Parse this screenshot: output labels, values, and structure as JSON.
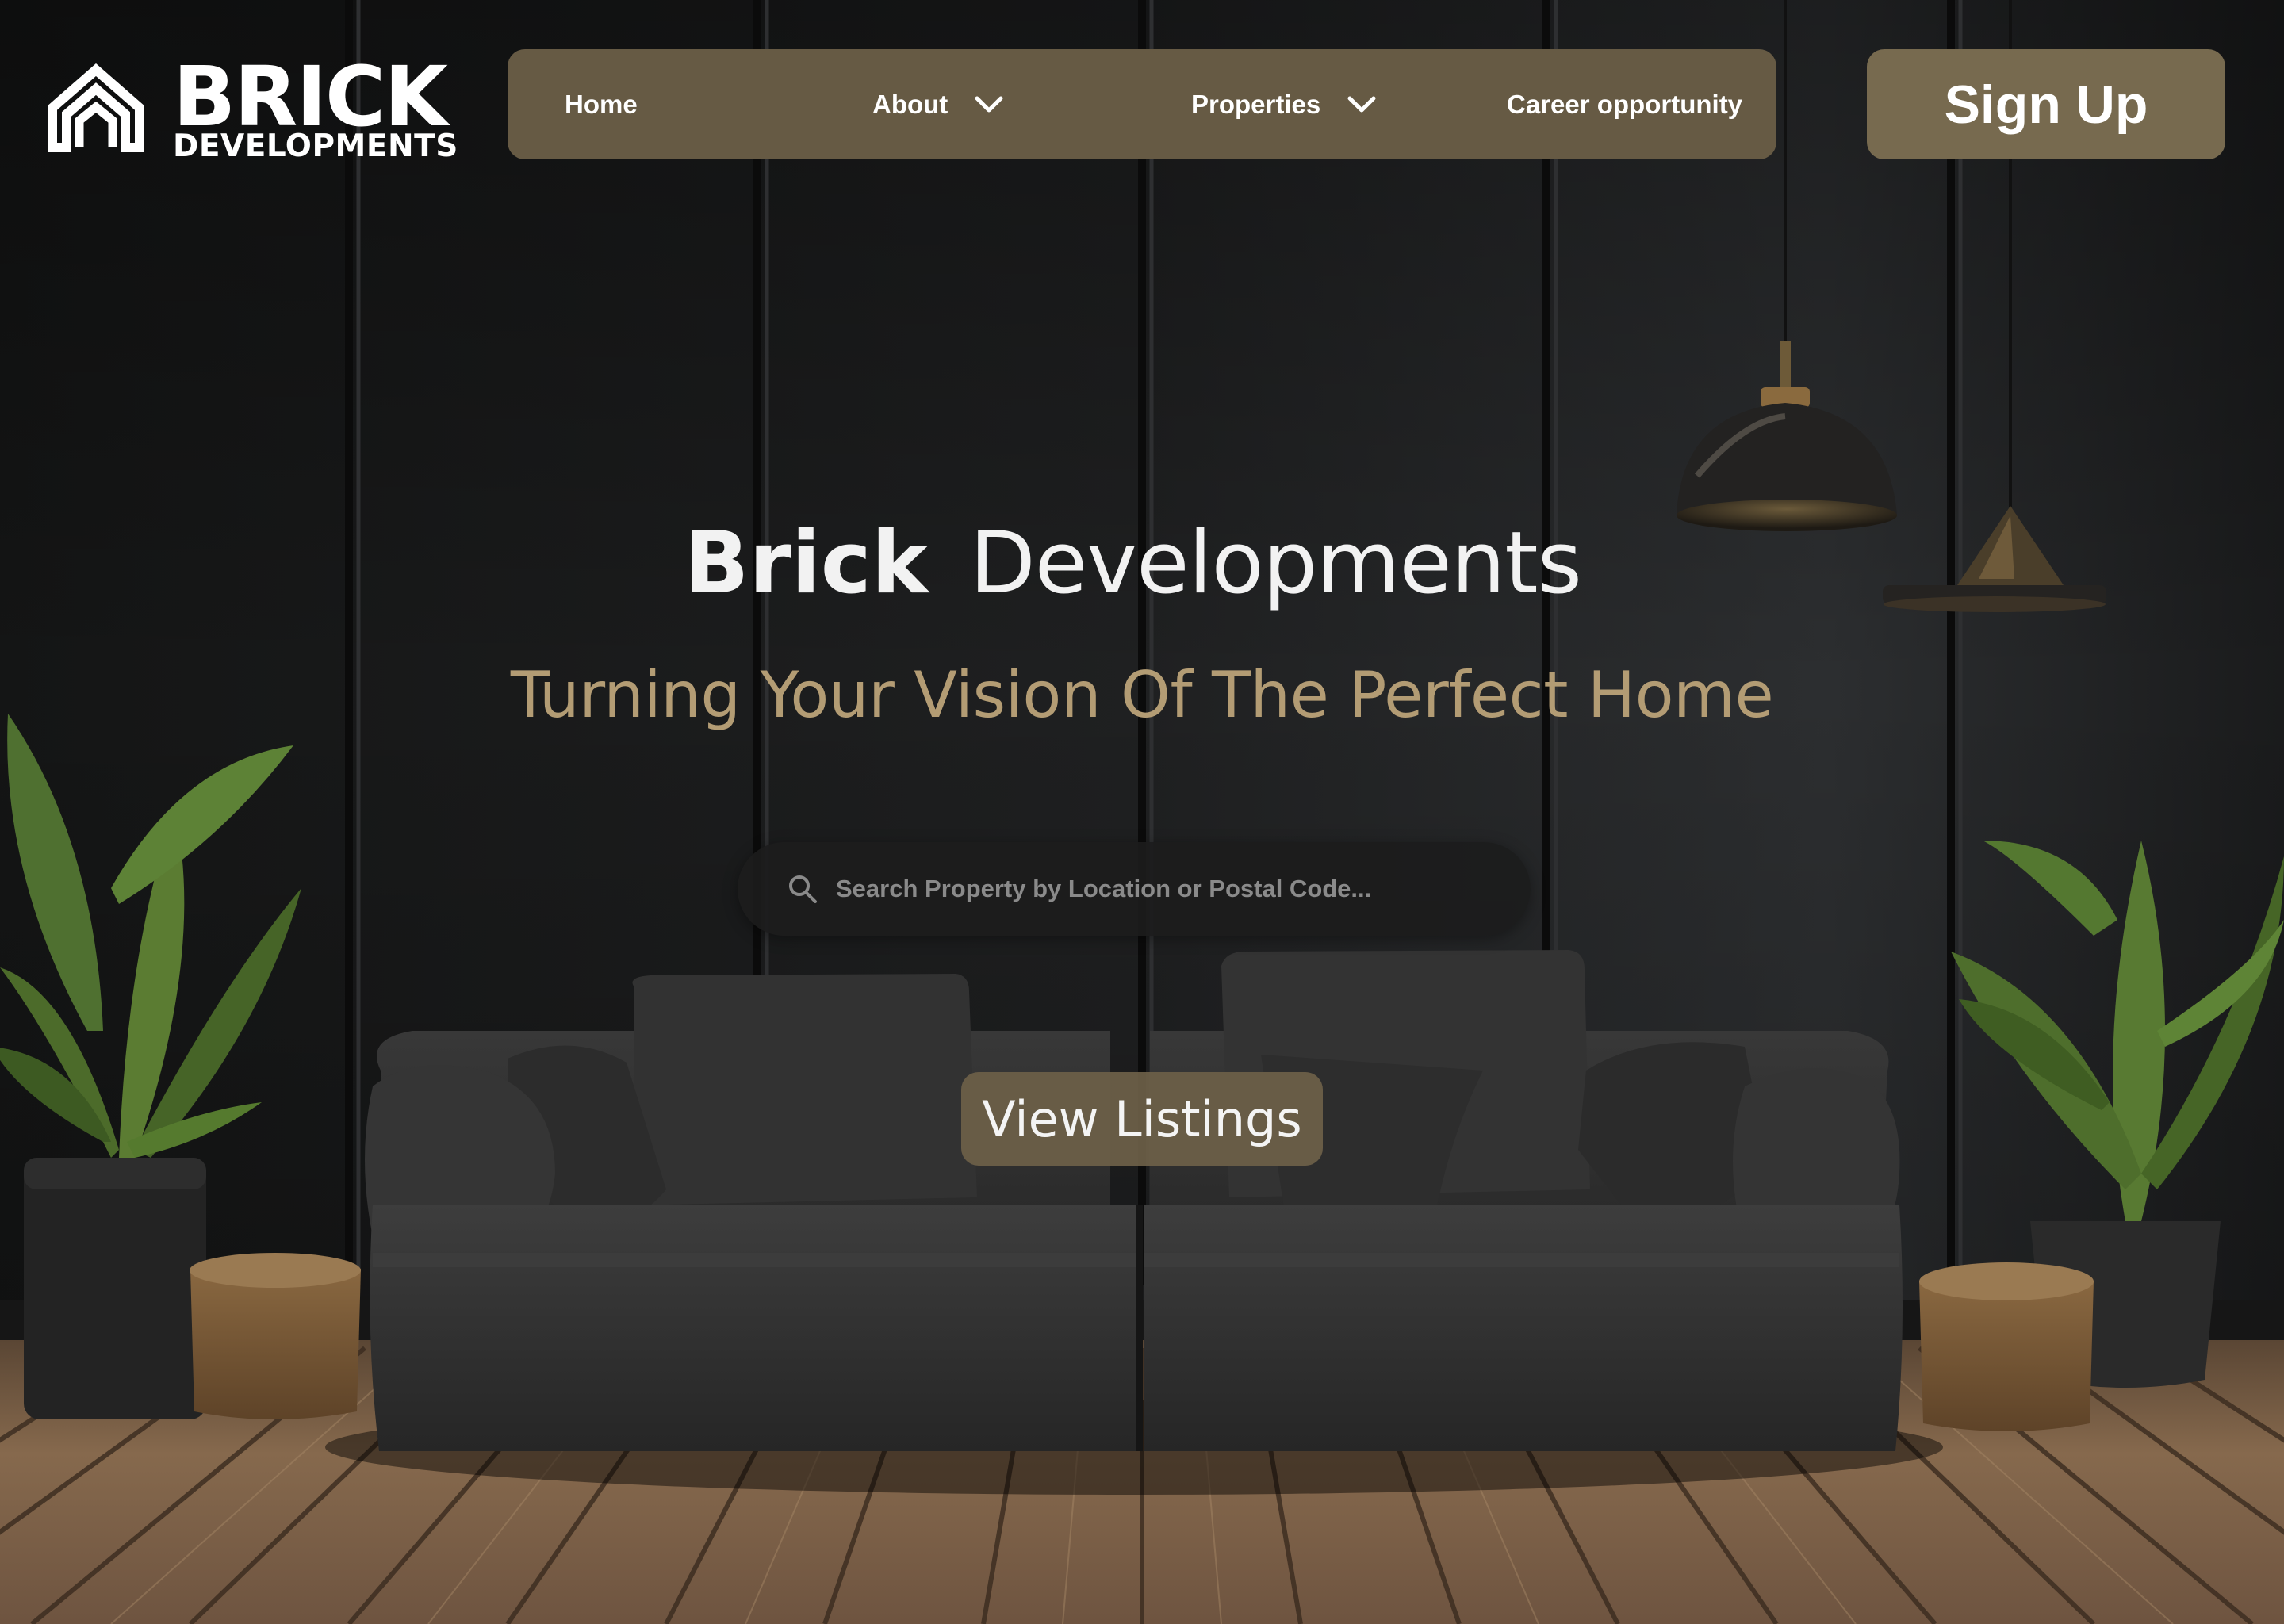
{
  "brand": {
    "name": "BRICK",
    "subtitle": "DEVELOPMENTS"
  },
  "nav": {
    "items": [
      {
        "label": "Home",
        "has_dropdown": false
      },
      {
        "label": "About",
        "has_dropdown": true
      },
      {
        "label": "Properties",
        "has_dropdown": true
      },
      {
        "label": "Career opportunity",
        "has_dropdown": false
      }
    ],
    "dropdown_icon": "chevron-down-icon"
  },
  "signup": {
    "label": "Sign Up"
  },
  "hero": {
    "title_bold": "Brick",
    "title_light": "Developments",
    "subtitle": "Turning Your Vision Of The Perfect Home"
  },
  "search": {
    "icon": "search-icon",
    "placeholder": "Search Property by Location or Postal Code...",
    "value": ""
  },
  "cta": {
    "label": "View Listings"
  },
  "colors": {
    "nav_bg": "#665a44",
    "button_bg": "#776a4f",
    "accent_text": "#b39c74",
    "wall": "#1c1d1e",
    "floor": "#8a6d50"
  }
}
